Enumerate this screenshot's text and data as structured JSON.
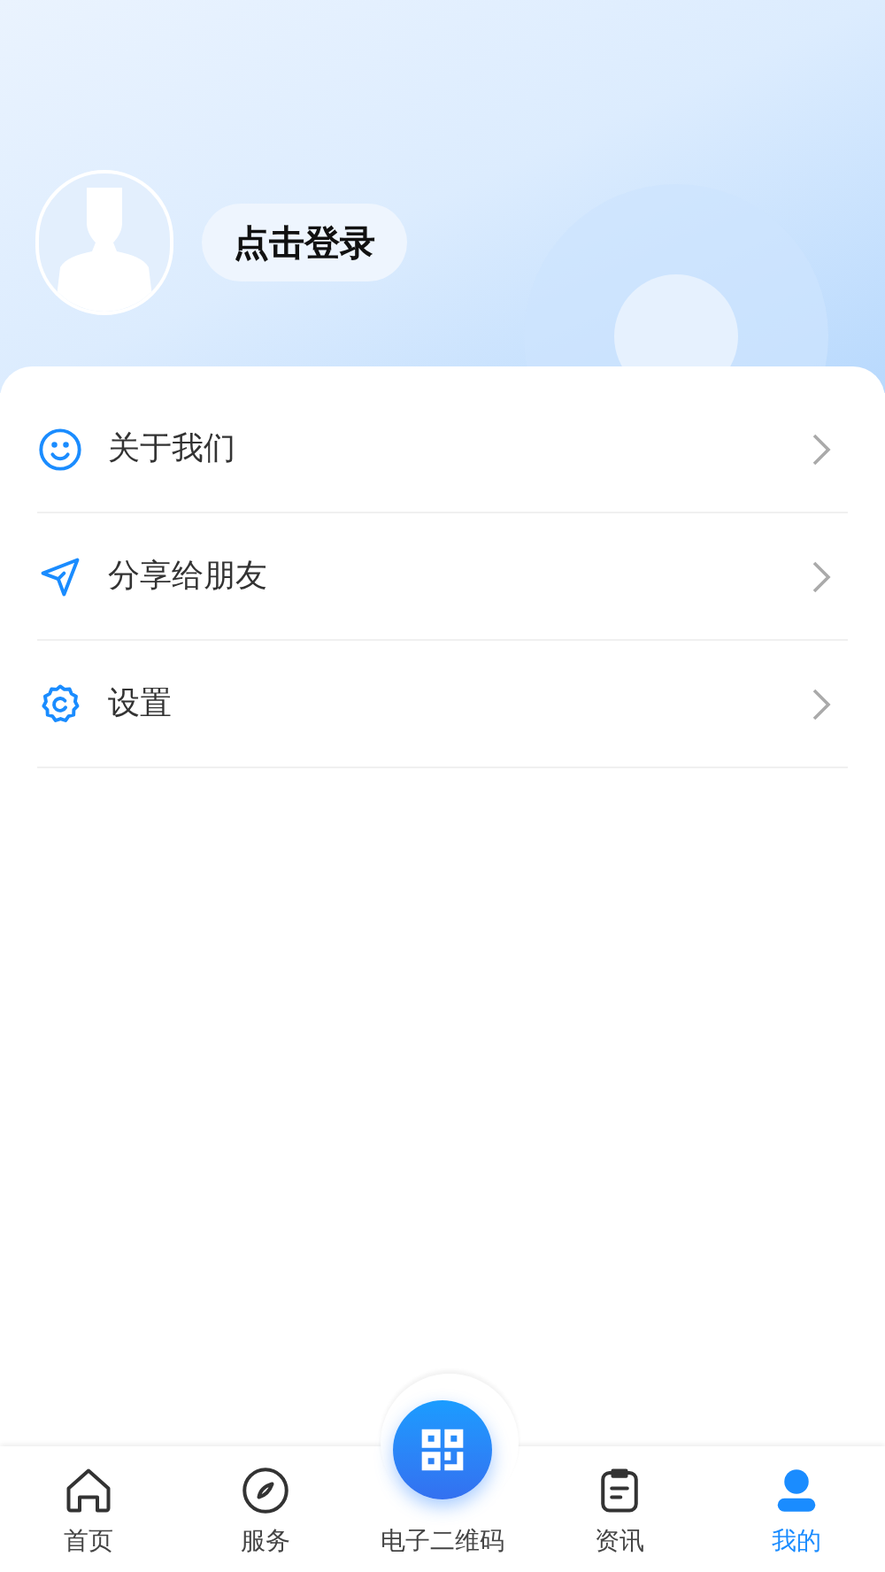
{
  "profile": {
    "login_label": "点击登录"
  },
  "menu": [
    {
      "kind": "smile",
      "label": "关于我们"
    },
    {
      "kind": "send",
      "label": "分享给朋友"
    },
    {
      "kind": "gear",
      "label": "设置"
    }
  ],
  "tab_bar": [
    {
      "kind": "home",
      "label": "首页",
      "selected": false
    },
    {
      "kind": "compass",
      "label": "服务",
      "selected": false
    },
    {
      "kind": "qr",
      "label": "电子二维码",
      "selected": false
    },
    {
      "kind": "clipboard",
      "label": "资讯",
      "selected": false
    },
    {
      "kind": "person",
      "label": "我的",
      "selected": true
    }
  ]
}
